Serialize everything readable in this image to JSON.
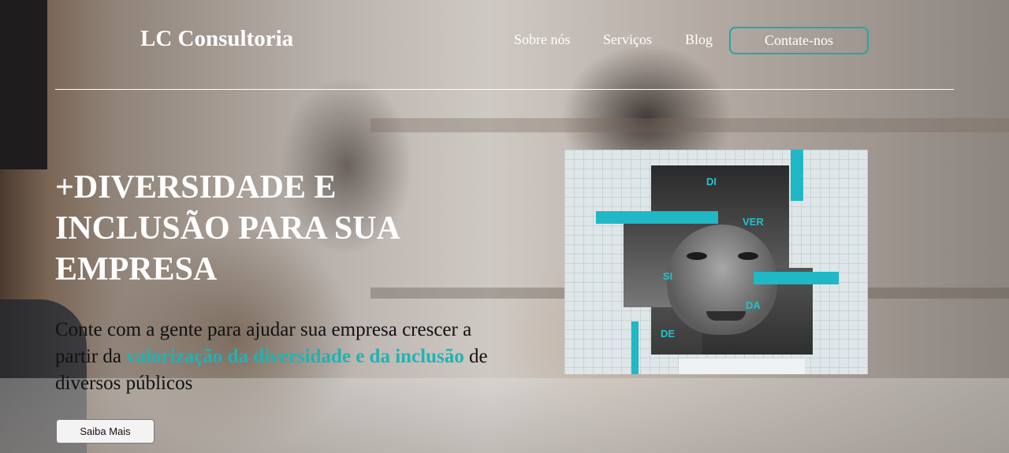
{
  "brand": {
    "name": "LC Consultoria"
  },
  "nav": {
    "links": [
      "Sobre nós",
      "Serviços",
      "Blog"
    ],
    "contact_label": "Contate-nos"
  },
  "hero": {
    "title": "+DIVERSIDADE E INCLUSÃO PARA SUA EMPRESA",
    "text_part1": "Conte com a gente para ajudar sua empresa crescer a partir da ",
    "text_highlight": "valorização da diversidade e da inclusão",
    "text_part2": " de diversos públicos",
    "cta_label": "Saiba Mais"
  },
  "collage": {
    "labels": [
      "DI",
      "VER",
      "SI",
      "DA",
      "DE"
    ]
  },
  "colors": {
    "accent": "#1fb3b3",
    "text_light": "#ffffff",
    "text_dark": "#111111"
  }
}
